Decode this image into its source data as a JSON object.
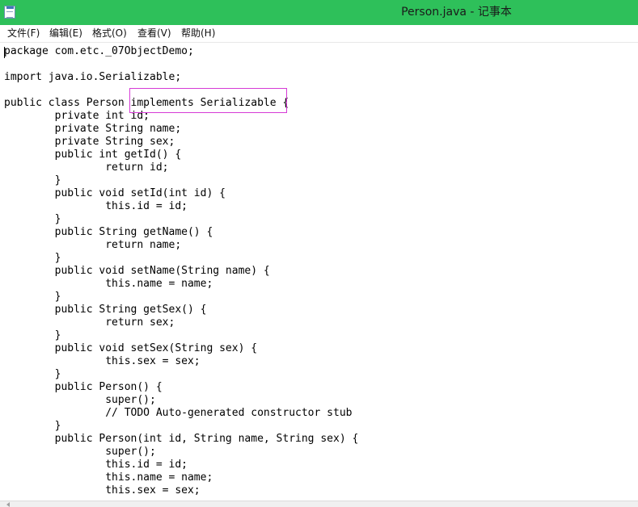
{
  "window": {
    "title": "Person.java - 记事本"
  },
  "menu": {
    "items": [
      "文件(F)",
      "编辑(E)",
      "格式(O)",
      "查看(V)",
      "帮助(H)"
    ]
  },
  "editor": {
    "lines": [
      "package com.etc._07ObjectDemo;",
      "",
      "import java.io.Serializable;",
      "",
      "public class Person implements Serializable {",
      "        private int id;",
      "        private String name;",
      "        private String sex;",
      "        public int getId() {",
      "                return id;",
      "        }",
      "        public void setId(int id) {",
      "                this.id = id;",
      "        }",
      "        public String getName() {",
      "                return name;",
      "        }",
      "        public void setName(String name) {",
      "                this.name = name;",
      "        }",
      "        public String getSex() {",
      "                return sex;",
      "        }",
      "        public void setSex(String sex) {",
      "                this.sex = sex;",
      "        }",
      "        public Person() {",
      "                super();",
      "                // TODO Auto-generated constructor stub",
      "        }",
      "        public Person(int id, String name, String sex) {",
      "                super();",
      "                this.id = id;",
      "                this.name = name;",
      "                this.sex = sex;"
    ]
  },
  "colors": {
    "titlebar": "#2ec05a",
    "highlight_border": "#d63bd6"
  }
}
